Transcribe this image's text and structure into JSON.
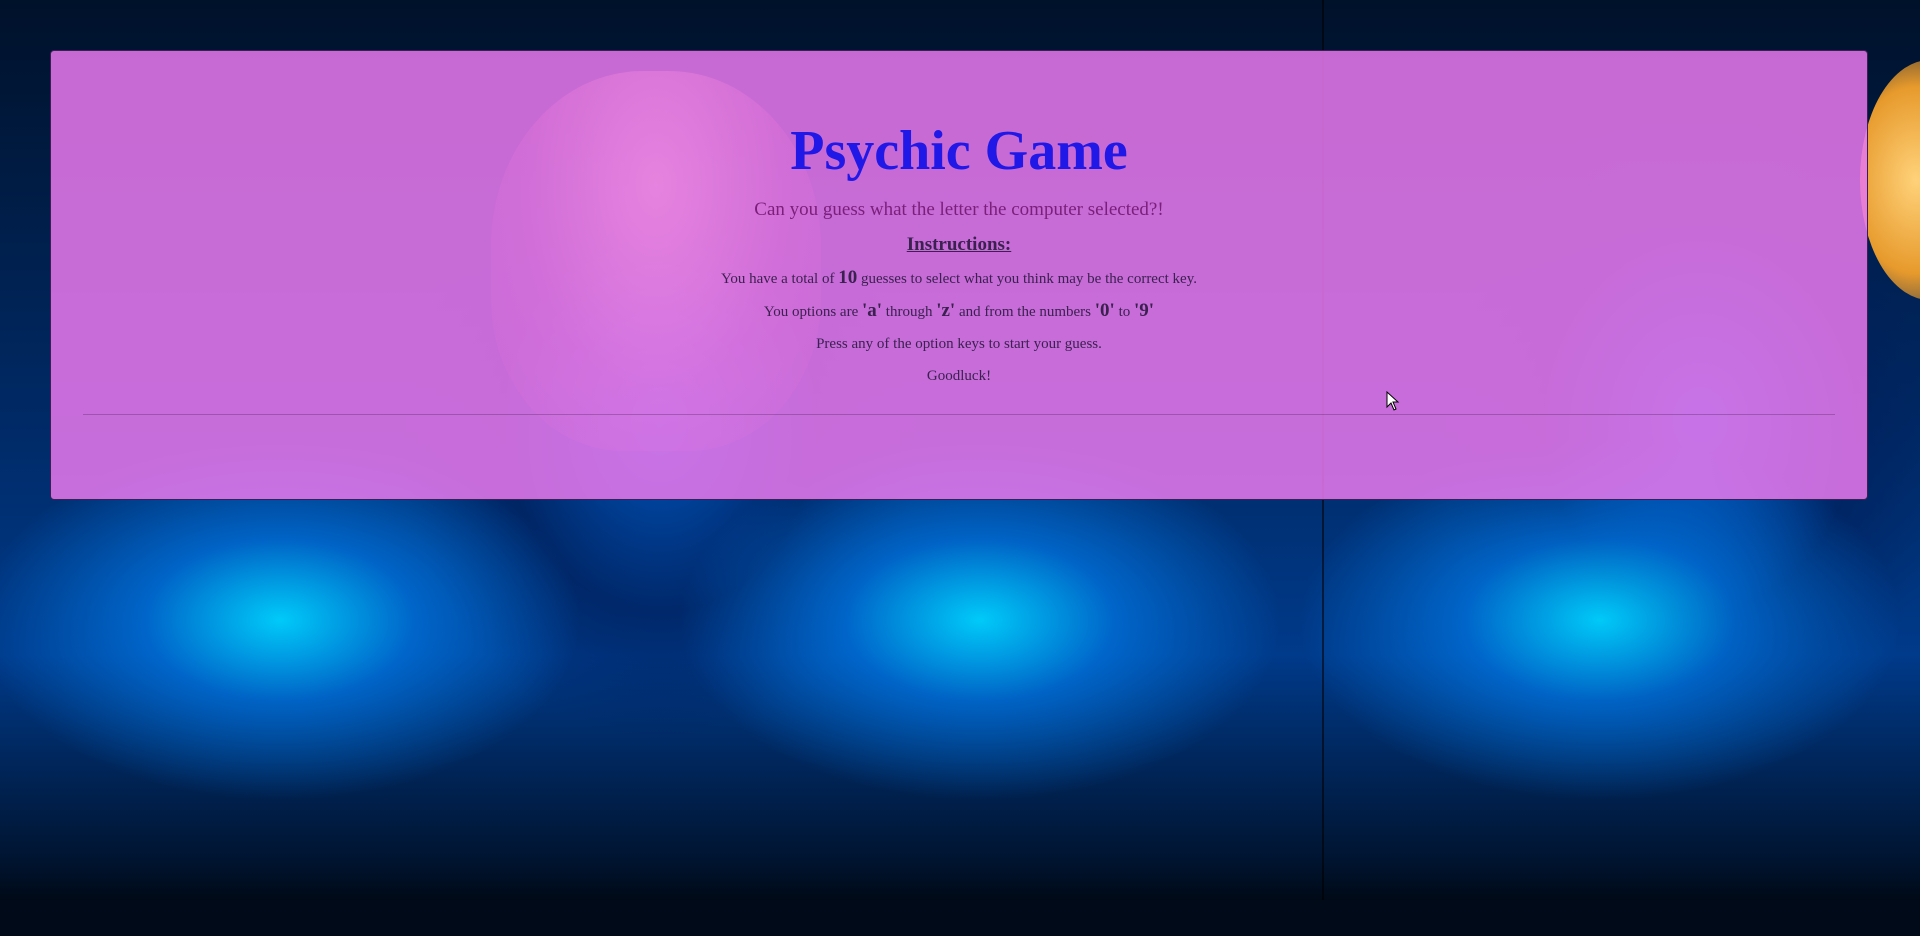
{
  "page": {
    "title": "Psychic Game",
    "subtitle": "Can you guess what the letter the computer selected?!",
    "instructions_heading": "Instructions:",
    "line1": {
      "before": "You have a total of ",
      "count": "10",
      "after": " guesses to select what you think may be the correct key."
    },
    "line2": {
      "part1": "You options are ",
      "a": "'a'",
      "part2": " through ",
      "z": "'z'",
      "part3": " and from the numbers ",
      "zero": "'0'",
      "part4": " to ",
      "nine": "'9'"
    },
    "line3": "Press any of the option keys to start your guess.",
    "line4": "Goodluck!"
  },
  "colors": {
    "title": "#1f18e6",
    "subtitle": "#7a1f7a",
    "panel": "#e878ee",
    "text": "#3b2150"
  }
}
